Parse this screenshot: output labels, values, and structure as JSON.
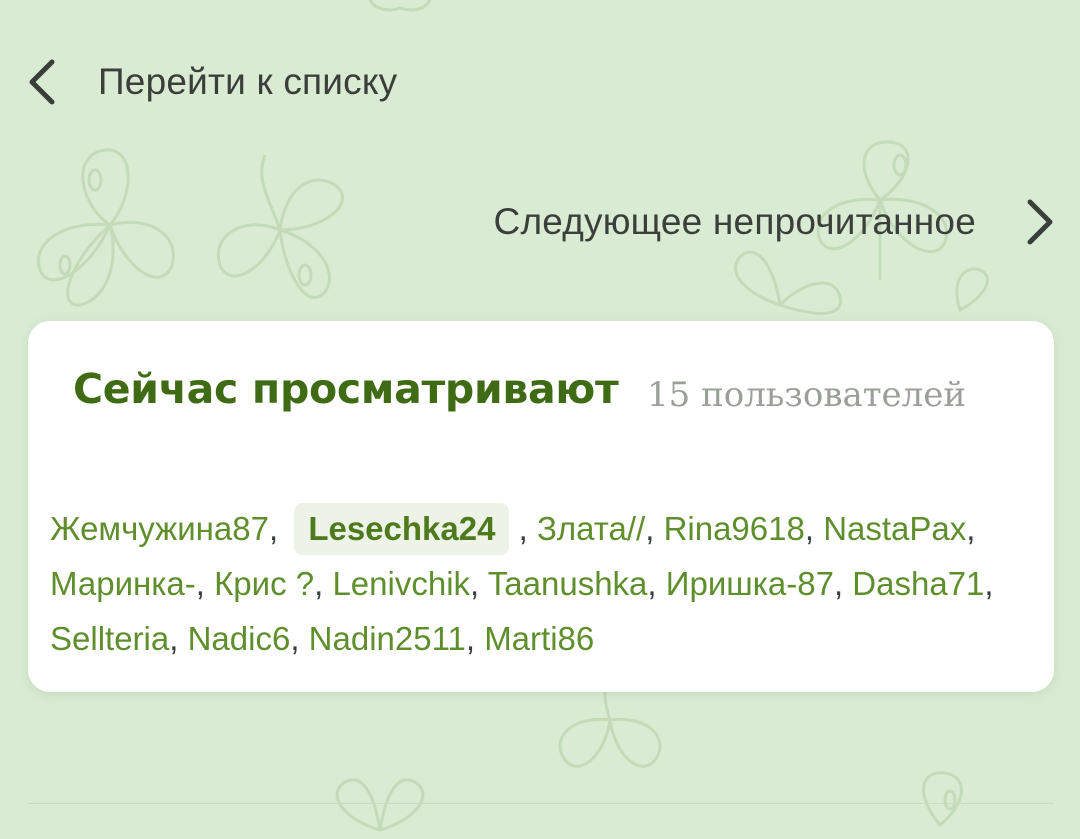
{
  "nav": {
    "back_label": "Перейти к списку",
    "next_label": "Следующее непрочитанное"
  },
  "viewers": {
    "title": "Сейчас просматривают",
    "count": "15 пользователей",
    "users": [
      {
        "name": "Жемчужина87",
        "highlight": false
      },
      {
        "name": "Lesechka24",
        "highlight": true
      },
      {
        "name": "Злата//",
        "highlight": false
      },
      {
        "name": "Rina9618",
        "highlight": false
      },
      {
        "name": "NastaPax",
        "highlight": false
      },
      {
        "name": "Маринка-",
        "highlight": false
      },
      {
        "name": "Крис ?",
        "highlight": false
      },
      {
        "name": "Lenivchik",
        "highlight": false
      },
      {
        "name": "Taanushka",
        "highlight": false
      },
      {
        "name": "Иришка-87",
        "highlight": false
      },
      {
        "name": "Dasha71",
        "highlight": false
      },
      {
        "name": "Sellteria",
        "highlight": false
      },
      {
        "name": "Nadic6",
        "highlight": false
      },
      {
        "name": "Nadin2511",
        "highlight": false
      },
      {
        "name": "Marti86",
        "highlight": false
      }
    ]
  },
  "colors": {
    "background": "#d9ecd3",
    "accent_green": "#3f6b15",
    "link_green": "#5f8f2d",
    "muted": "#9a9f99"
  },
  "icons": {
    "back": "chevron-left-icon",
    "next": "chevron-right-icon",
    "background": "clover-pattern"
  }
}
